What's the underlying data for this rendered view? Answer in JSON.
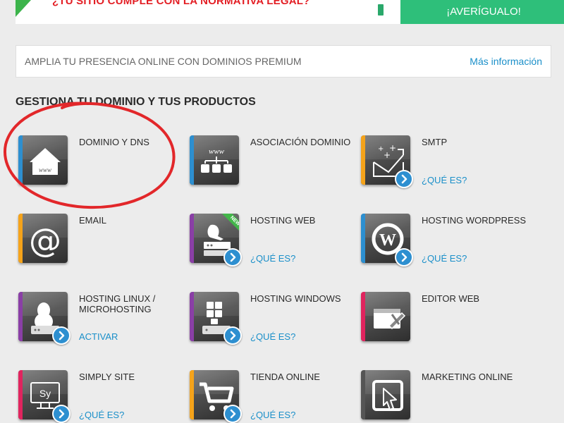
{
  "banner": {
    "headline": "¿TU SITIO CUMPLE CON LA NORMATIVA LEGAL?",
    "cta_label": "¡AVERÍGUALO!",
    "accent_color": "#2ebf7a",
    "alert_color": "#e31e24"
  },
  "promo": {
    "text": "AMPLIA TU PRESENCIA ONLINE CON DOMINIOS PREMIUM",
    "link_label": "Más información"
  },
  "section_title": "GESTIONA TU DOMINIO Y TUS PRODUCTOS",
  "products": [
    {
      "name": "DOMINIO Y DNS",
      "action": "",
      "icon": "home-www-icon",
      "stripe": "#2d8fd0",
      "arrow": false
    },
    {
      "name": "ASOCIACIÓN DOMINIO",
      "action": "",
      "icon": "domain-association-icon",
      "stripe": "#2d8fd0",
      "arrow": false
    },
    {
      "name": "SMTP",
      "action": "¿QUÉ ES?",
      "icon": "smtp-mail-icon",
      "stripe": "#f5a31a",
      "arrow": true
    },
    {
      "name": "EMAIL",
      "action": "",
      "icon": "at-sign-icon",
      "stripe": "#f5a31a",
      "arrow": false
    },
    {
      "name": "HOSTING WEB",
      "action": "¿QUÉ ES?",
      "icon": "hosting-web-icon",
      "stripe": "#8a3fa6",
      "arrow": true,
      "badge": "NEW"
    },
    {
      "name": "HOSTING WORDPRESS",
      "action": "¿QUÉ ES?",
      "icon": "wordpress-icon",
      "stripe": "#2d8fd0",
      "arrow": true
    },
    {
      "name": "HOSTING LINUX / MICROHOSTING",
      "action": "ACTIVAR",
      "icon": "linux-penguin-icon",
      "stripe": "#8a3fa6",
      "arrow": true
    },
    {
      "name": "HOSTING WINDOWS",
      "action": "¿QUÉ ES?",
      "icon": "windows-server-icon",
      "stripe": "#8a3fa6",
      "arrow": true
    },
    {
      "name": "EDITOR WEB",
      "action": "",
      "icon": "web-editor-icon",
      "stripe": "#e0245e",
      "arrow": false
    },
    {
      "name": "SIMPLY SITE",
      "action": "¿QUÉ ES?",
      "icon": "simply-site-icon",
      "stripe": "#e0245e",
      "arrow": true
    },
    {
      "name": "TIENDA ONLINE",
      "action": "¿QUÉ ES?",
      "icon": "shopping-cart-icon",
      "stripe": "#f5a31a",
      "arrow": true
    },
    {
      "name": "MARKETING ONLINE",
      "action": "",
      "icon": "marketing-cursor-icon",
      "stripe": "#555555",
      "arrow": false
    }
  ]
}
